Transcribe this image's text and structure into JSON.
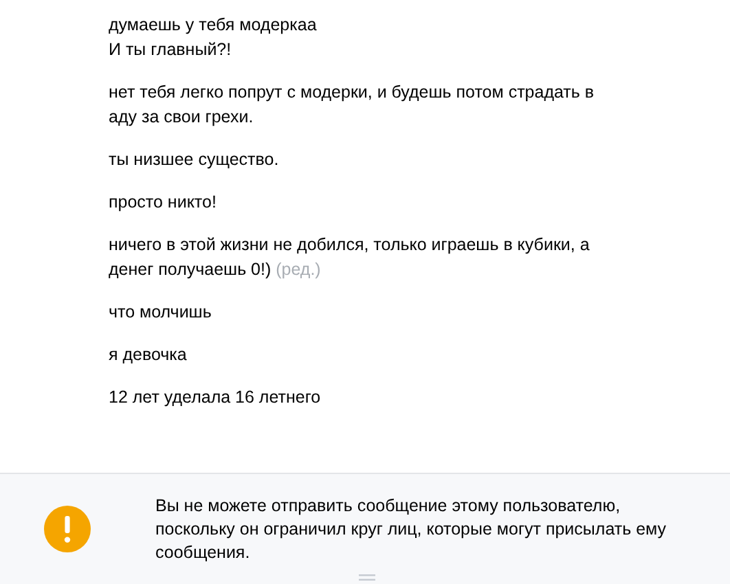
{
  "messages": [
    {
      "lines": [
        "думаешь у тебя модеркаа",
        "И ты главный?!"
      ]
    },
    {
      "lines": [
        "нет тебя легко попрут с модерки, и будешь потом страдать в",
        "аду за свои грехи."
      ]
    },
    {
      "lines": [
        "ты низшее существо."
      ]
    },
    {
      "lines": [
        "просто никто!"
      ]
    },
    {
      "lines": [
        "ничего в этой жизни не добился, только играешь в кубики, а",
        "денег получаешь 0!)"
      ],
      "edited_label": "(ред.)"
    },
    {
      "lines": [
        "что молчишь"
      ]
    },
    {
      "lines": [
        "я девочка"
      ]
    },
    {
      "lines": [
        "12 лет уделала 16 летнего"
      ]
    }
  ],
  "notice": {
    "text": "Вы не можете отправить сообщение этому пользователю, поскольку он ограничил круг лиц, которые могут присылать ему сообщения."
  }
}
